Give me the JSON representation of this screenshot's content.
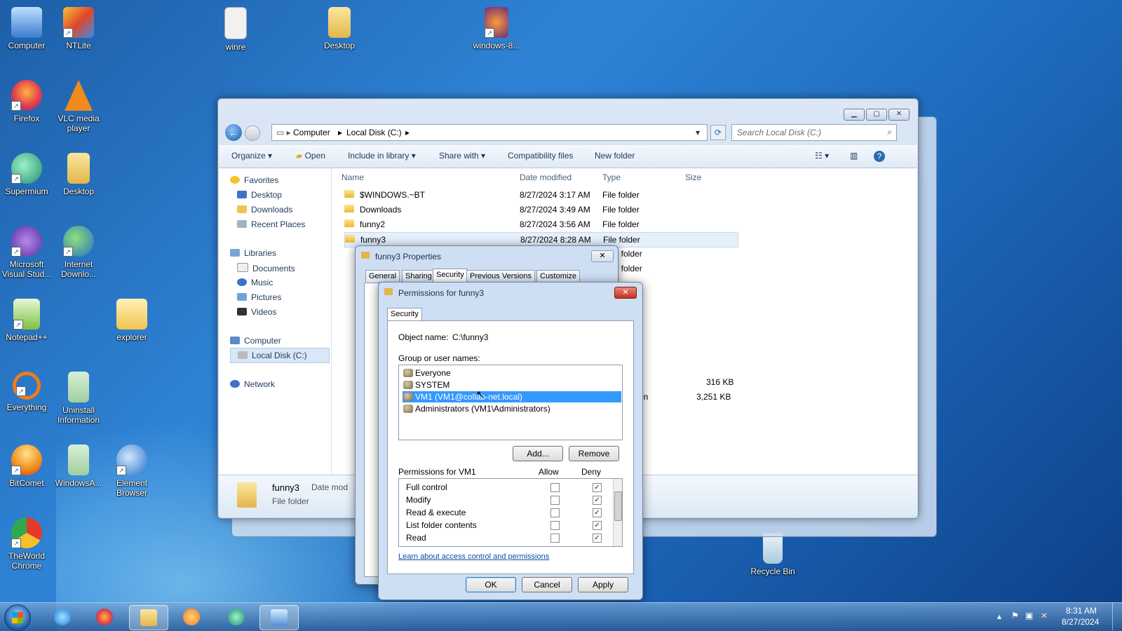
{
  "desktop": {
    "icons": [
      {
        "label": "Computer",
        "icon": "computer-icon"
      },
      {
        "label": "NTLite",
        "icon": "ntlite-icon"
      },
      {
        "label": "winre",
        "icon": "disc-image-icon"
      },
      {
        "label": "Desktop",
        "icon": "folder-icon"
      },
      {
        "label": "windows-8...",
        "icon": "firefox-file-icon"
      },
      {
        "label": "Firefox",
        "icon": "firefox-icon"
      },
      {
        "label": "VLC media player",
        "icon": "vlc-icon"
      },
      {
        "label": "Supermium",
        "icon": "supermium-icon"
      },
      {
        "label": "Desktop",
        "icon": "folder-icon"
      },
      {
        "label": "Microsoft Visual Stud...",
        "icon": "visual-studio-icon"
      },
      {
        "label": "Internet Downlo...",
        "icon": "idm-icon"
      },
      {
        "label": "Notepad++",
        "icon": "notepad-plus-icon"
      },
      {
        "label": "explorer",
        "icon": "explorer-folder-icon"
      },
      {
        "label": "Everything",
        "icon": "everything-search-icon"
      },
      {
        "label": "Uninstall Information",
        "icon": "folder-icon"
      },
      {
        "label": "BitComet",
        "icon": "bitcomet-icon"
      },
      {
        "label": "WindowsA...",
        "icon": "folder-icon"
      },
      {
        "label": "Element Browser",
        "icon": "element-browser-icon"
      },
      {
        "label": "TheWorld Chrome",
        "icon": "theworld-chrome-icon"
      },
      {
        "label": "Recycle Bin",
        "icon": "recycle-bin-icon"
      }
    ]
  },
  "explorer": {
    "breadcrumb": [
      "Computer",
      "Local Disk (C:)"
    ],
    "search_placeholder": "Search Local Disk (C:)",
    "toolbar": {
      "organize": "Organize",
      "open": "Open",
      "include_in_library": "Include in library",
      "share_with": "Share with",
      "compatibility_files": "Compatibility files",
      "new_folder": "New folder"
    },
    "nav": {
      "favorites": "Favorites",
      "favorites_items": [
        "Desktop",
        "Downloads",
        "Recent Places"
      ],
      "libraries": "Libraries",
      "libraries_items": [
        "Documents",
        "Music",
        "Pictures",
        "Videos"
      ],
      "computer": "Computer",
      "local_disk": "Local Disk (C:)",
      "network": "Network"
    },
    "columns": [
      "Name",
      "Date modified",
      "Type",
      "Size"
    ],
    "rows": [
      {
        "name": "$WINDOWS.~BT",
        "date": "8/27/2024 3:17 AM",
        "type": "File folder",
        "size": ""
      },
      {
        "name": "Downloads",
        "date": "8/27/2024 3:49 AM",
        "type": "File folder",
        "size": ""
      },
      {
        "name": "funny2",
        "date": "8/27/2024 3:56 AM",
        "type": "File folder",
        "size": ""
      },
      {
        "name": "funny3",
        "date": "8/27/2024 8:28 AM",
        "type": "File folder",
        "size": ""
      }
    ],
    "partial_types": [
      "File folder",
      "File folder"
    ],
    "partial_sizes": [
      "316 KB",
      "3,251 KB"
    ],
    "partial_type_tail": "tion",
    "details": {
      "name": "funny3",
      "kind": "File folder",
      "date_label": "Date mod"
    }
  },
  "properties_dialog": {
    "title": "funny3 Properties",
    "tabs": [
      "General",
      "Sharing",
      "Security",
      "Previous Versions",
      "Customize"
    ],
    "active_tab": "Security"
  },
  "permissions_dialog": {
    "title": "Permissions for funny3",
    "tab": "Security",
    "object_name_label": "Object name:",
    "object_name": "C:\\funny3",
    "group_label": "Group or user names:",
    "users": [
      {
        "name": "Everyone",
        "selected": false
      },
      {
        "name": "SYSTEM",
        "selected": false
      },
      {
        "name": "VM1 (VM1@collab-net.local)",
        "selected": true
      },
      {
        "name": "Administrators (VM1\\Administrators)",
        "selected": false
      }
    ],
    "add_button": "Add...",
    "remove_button": "Remove",
    "permissions_for": "Permissions for VM1",
    "allow_header": "Allow",
    "deny_header": "Deny",
    "permissions": [
      {
        "name": "Full control",
        "allow": false,
        "deny": true
      },
      {
        "name": "Modify",
        "allow": false,
        "deny": true
      },
      {
        "name": "Read & execute",
        "allow": false,
        "deny": true
      },
      {
        "name": "List folder contents",
        "allow": false,
        "deny": true
      },
      {
        "name": "Read",
        "allow": false,
        "deny": true
      }
    ],
    "learn_link": "Learn about access control and permissions",
    "ok": "OK",
    "cancel": "Cancel",
    "apply": "Apply"
  },
  "taskbar": {
    "time": "8:31 AM",
    "date": "8/27/2024"
  }
}
